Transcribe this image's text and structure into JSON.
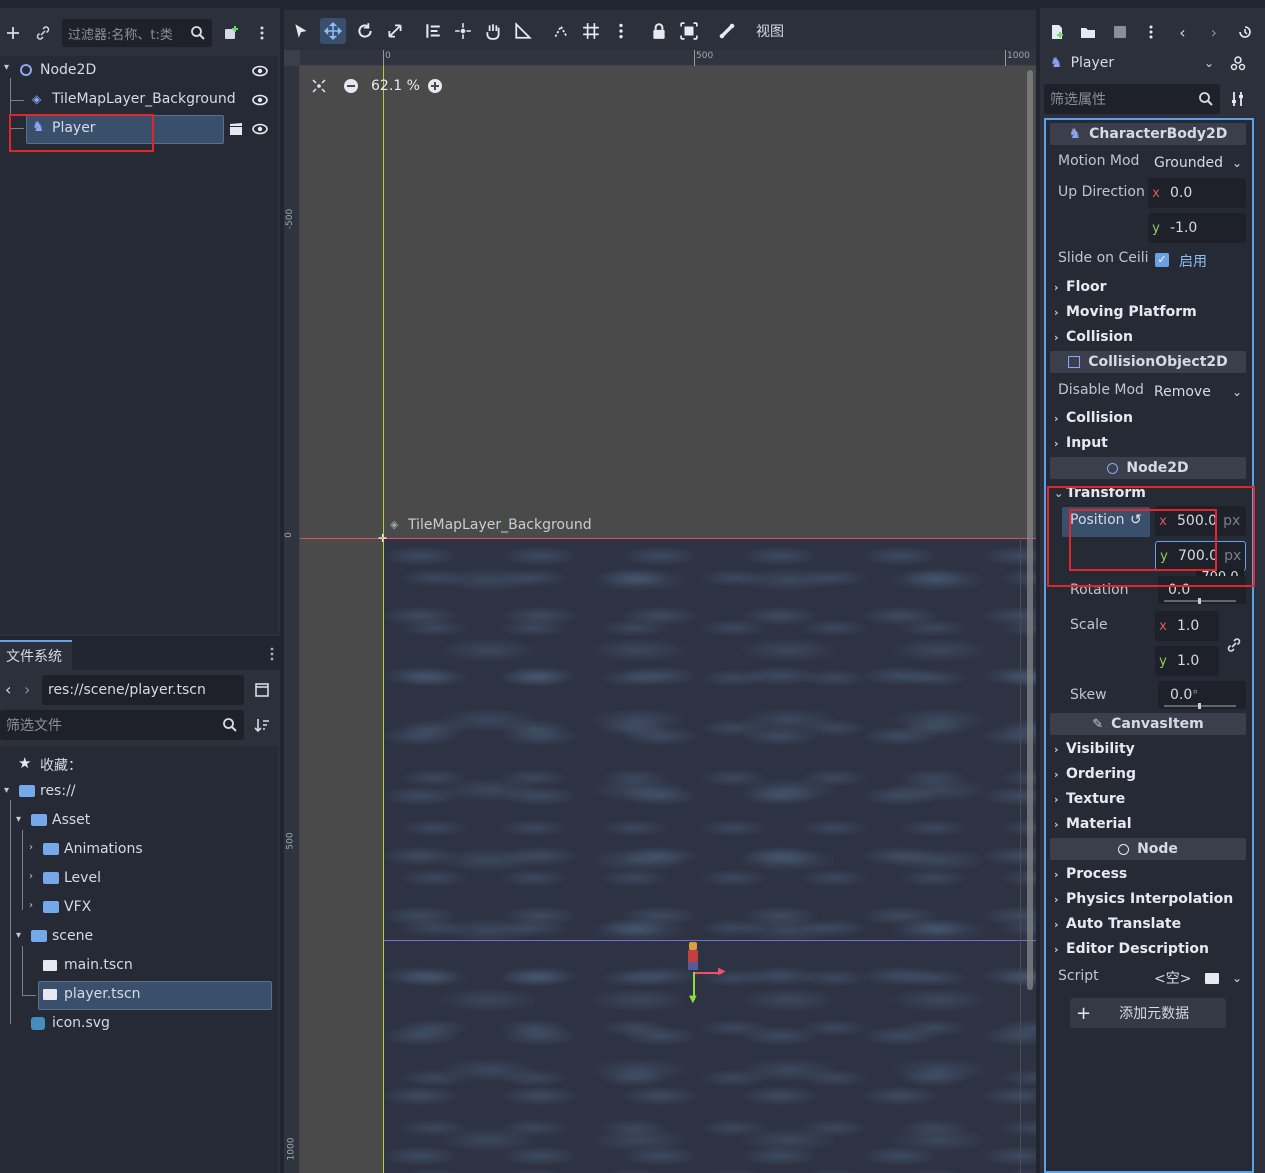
{
  "scene_panel": {
    "filter_placeholder": "过滤器:名称、t:类",
    "tree": [
      {
        "label": "Node2D"
      },
      {
        "label": "TileMapLayer_Background"
      },
      {
        "label": "Player"
      }
    ]
  },
  "filesystem": {
    "tab_label": "文件系统",
    "path": "res://scene/player.tscn",
    "filter_placeholder": "筛选文件",
    "favorites_label": "收藏：",
    "items": [
      {
        "label": "res://"
      },
      {
        "label": "Asset"
      },
      {
        "label": "Animations"
      },
      {
        "label": "Level"
      },
      {
        "label": "VFX"
      },
      {
        "label": "scene"
      },
      {
        "label": "main.tscn"
      },
      {
        "label": "player.tscn"
      },
      {
        "label": "icon.svg"
      }
    ]
  },
  "viewport": {
    "zoom": "62.1 %",
    "view_menu": "视图",
    "node_label": "TileMapLayer_Background",
    "ruler_top": [
      "0",
      "500",
      "1000"
    ],
    "ruler_left": [
      "-500",
      "0",
      "500",
      "1000"
    ]
  },
  "inspector": {
    "node_name": "Player",
    "filter_placeholder": "筛选属性",
    "sections": {
      "characterbody": "CharacterBody2D",
      "collisionobject": "CollisionObject2D",
      "node2d": "Node2D",
      "canvasitem": "CanvasItem",
      "node": "Node"
    },
    "motion_mode_label": "Motion Mod",
    "motion_mode_value": "Grounded",
    "up_direction_label": "Up Direction",
    "up_x": "0.0",
    "up_y": "-1.0",
    "slide_label": "Slide on Ceili",
    "slide_value": "启用",
    "cat_floor": "Floor",
    "cat_moving": "Moving Platform",
    "cat_collision": "Collision",
    "disable_mode_label": "Disable Mod",
    "disable_mode_value": "Remove",
    "cat_collision2": "Collision",
    "cat_input": "Input",
    "cat_transform": "Transform",
    "position_label": "Position",
    "pos_x": "500.0",
    "pos_y": "700.0",
    "unit": "px",
    "tooltip": "700.0",
    "rotation_label": "Rotation",
    "rotation_value": "0.0",
    "scale_label": "Scale",
    "scale_x": "1.0",
    "scale_y": "1.0",
    "skew_label": "Skew",
    "skew_value": "0.0",
    "degree": "°",
    "cat_visibility": "Visibility",
    "cat_ordering": "Ordering",
    "cat_texture": "Texture",
    "cat_material": "Material",
    "cat_process": "Process",
    "cat_physics": "Physics Interpolation",
    "cat_autotranslate": "Auto Translate",
    "cat_editordesc": "Editor Description",
    "script_label": "Script",
    "script_value": "<空>",
    "add_metadata": "添加元数据"
  },
  "axis_labels": {
    "x": "x",
    "y": "y"
  }
}
